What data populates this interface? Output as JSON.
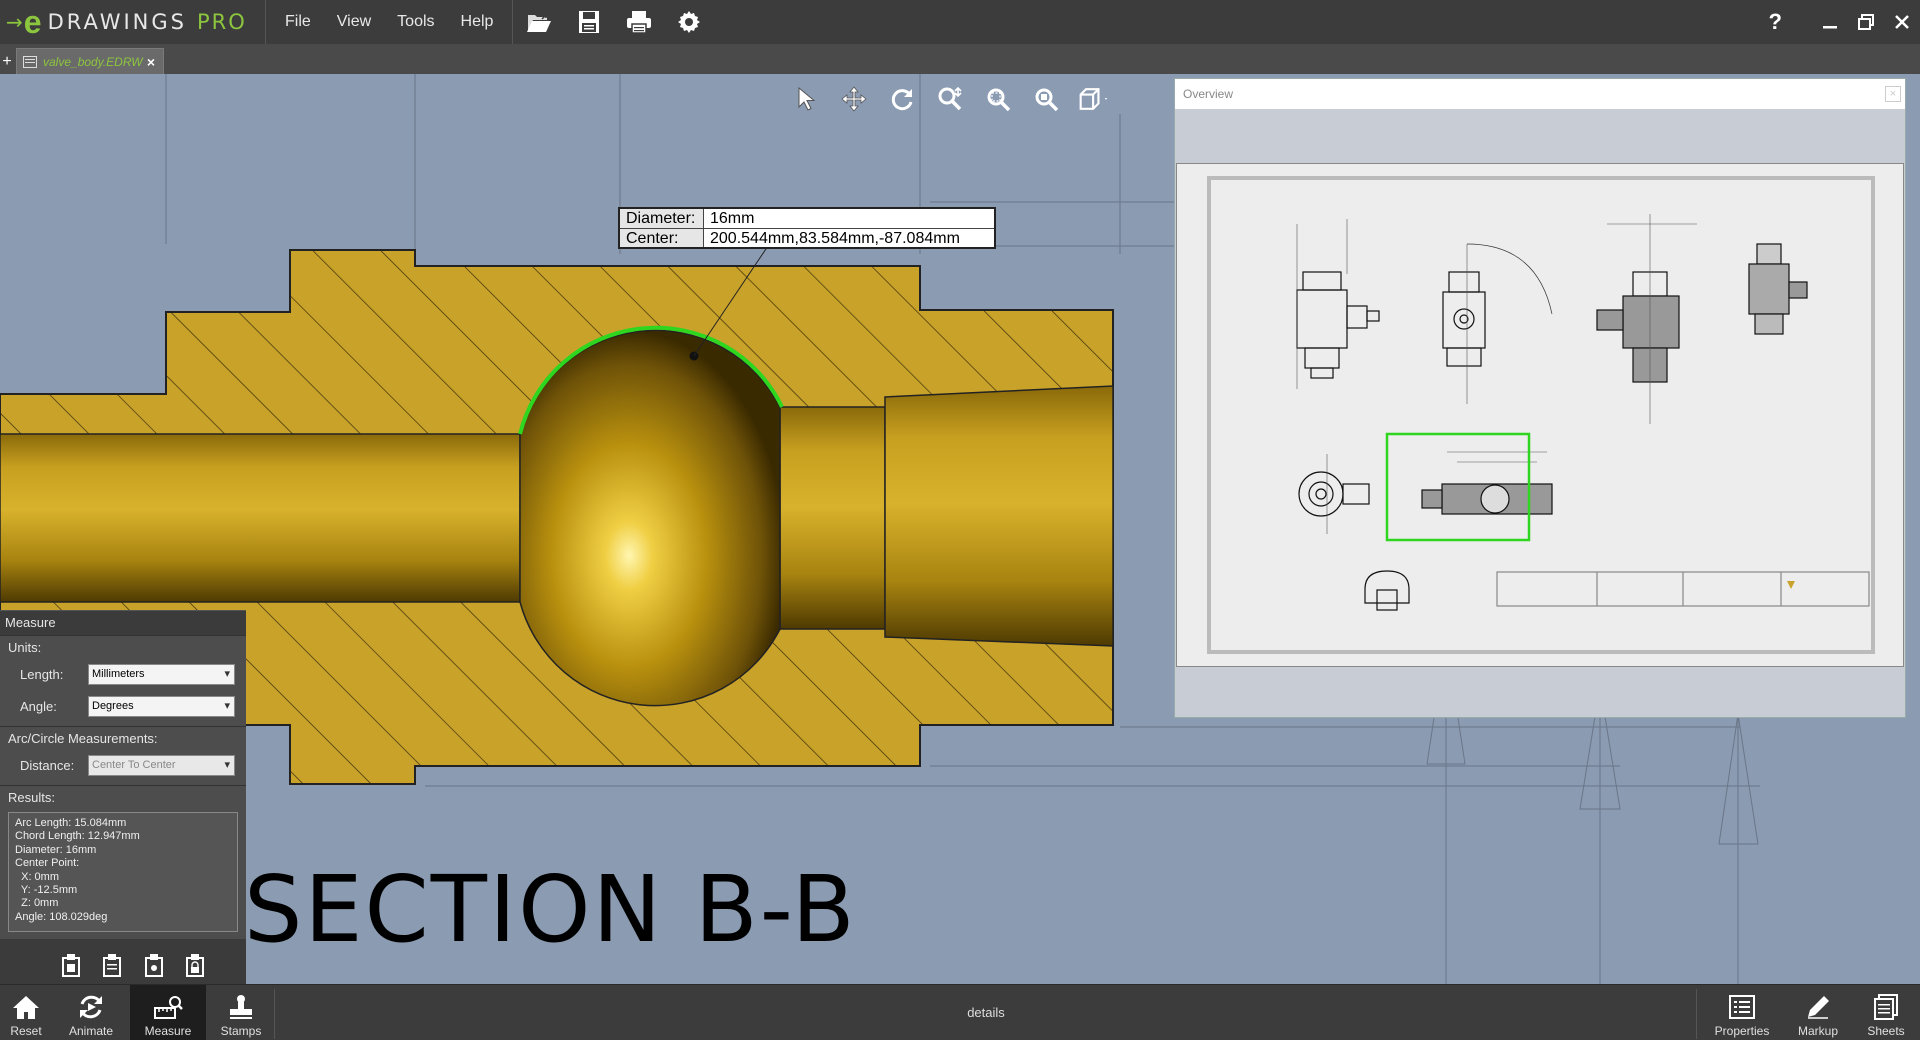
{
  "app": {
    "logo_e": "e",
    "logo_text": "DRAWINGS",
    "logo_pro": "PRO",
    "menu": [
      {
        "label": "File"
      },
      {
        "label": "View"
      },
      {
        "label": "Tools"
      },
      {
        "label": "Help"
      }
    ],
    "help_label": "?"
  },
  "tabs": {
    "add_label": "+",
    "doc_name": "valve_body.EDRW",
    "close_label": "×"
  },
  "measurement_tooltip": {
    "diameter_label": "Diameter:",
    "diameter_value": "16mm",
    "center_label": "Center:",
    "center_value": "200.544mm,83.584mm,-87.084mm"
  },
  "overview": {
    "title": "Overview",
    "close_label": "×"
  },
  "section_label": "SECTION B-B",
  "measure_panel": {
    "title": "Measure",
    "units_label": "Units:",
    "length_label": "Length:",
    "length_value": "Millimeters",
    "angle_label": "Angle:",
    "angle_value": "Degrees",
    "arc_label": "Arc/Circle Measurements:",
    "distance_label": "Distance:",
    "distance_value": "Center To Center",
    "results_label": "Results:",
    "results": [
      "Arc Length: 15.084mm",
      "Chord Length: 12.947mm",
      "Diameter: 16mm",
      "Center Point:",
      "  X: 0mm",
      "  Y: -12.5mm",
      "  Z: 0mm",
      "Angle: 108.029deg"
    ]
  },
  "bottom_bar": {
    "reset": "Reset",
    "animate": "Animate",
    "measure": "Measure",
    "stamps": "Stamps",
    "sheet_name": "details",
    "properties": "Properties",
    "markup": "Markup",
    "sheets": "Sheets"
  },
  "colors": {
    "accent_green": "#8cc63f",
    "viewport_bg": "#8a9bb2",
    "brass": "#c9a22a",
    "highlight_green": "#2ed61f"
  }
}
